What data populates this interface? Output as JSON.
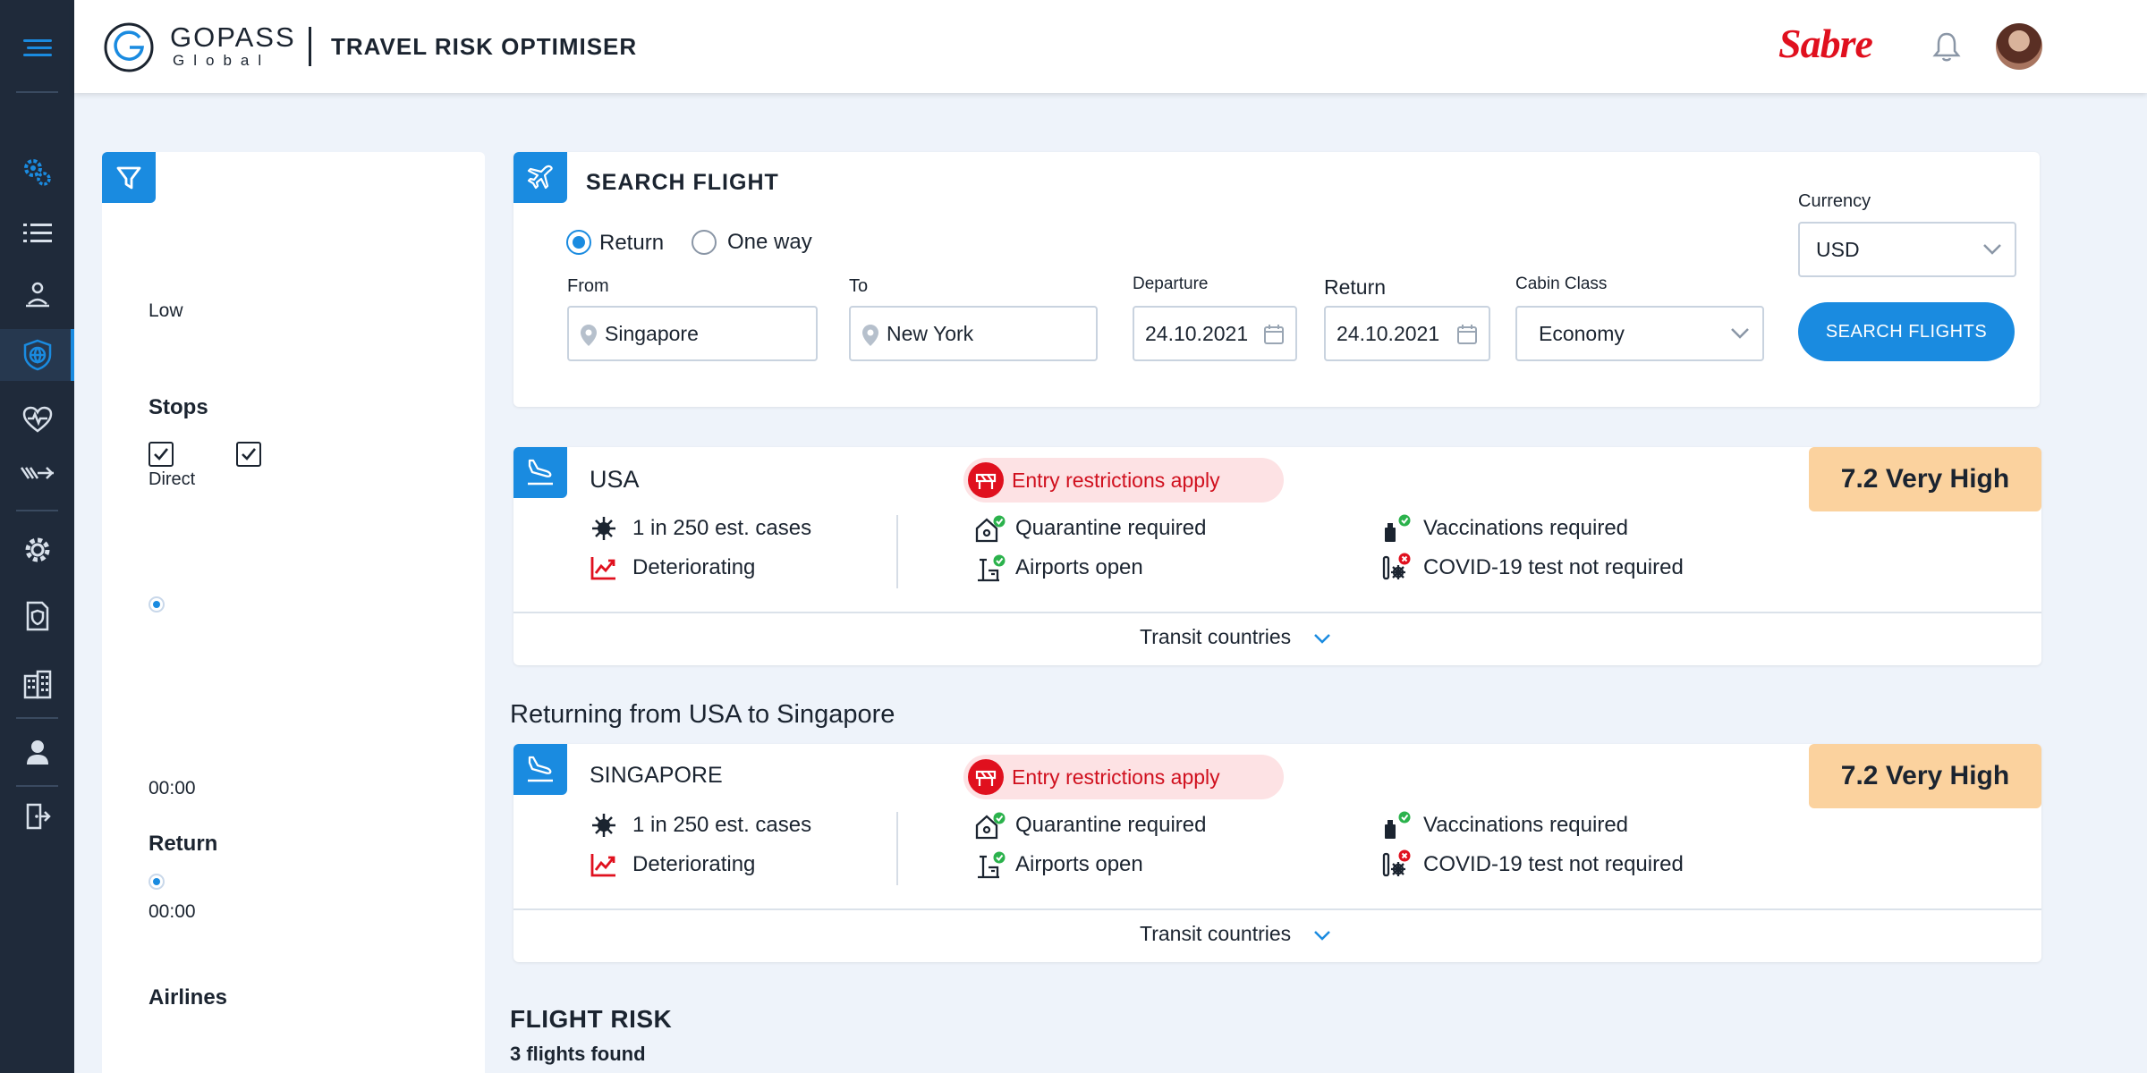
{
  "header": {
    "brand_line1": "GOPASS",
    "brand_line2": "Global",
    "app_title": "TRAVEL RISK OPTIMISER",
    "partner_logo": "Sabre",
    "icons": {
      "menu": "hamburger-icon",
      "bell": "bell-icon"
    }
  },
  "nav": {
    "items": [
      {
        "icon": "gears-icon",
        "active": false
      },
      {
        "icon": "list-icon",
        "active": false
      },
      {
        "icon": "location-person-icon",
        "active": false
      },
      {
        "icon": "shield-globe-icon",
        "active": true
      },
      {
        "icon": "heart-pulse-icon",
        "active": false
      },
      {
        "icon": "flight-speed-icon",
        "active": false
      },
      {
        "icon": "gear-icon",
        "active": false
      },
      {
        "icon": "document-shield-icon",
        "active": false
      },
      {
        "icon": "building-icon",
        "active": false
      },
      {
        "icon": "user-icon",
        "active": false
      },
      {
        "icon": "logout-icon",
        "active": false
      }
    ]
  },
  "filters": {
    "risk_level_label": "Low",
    "stops": {
      "heading": "Stops",
      "direct_label": "Direct"
    },
    "departure_time": "00:00",
    "return": {
      "heading": "Return",
      "time": "00:00"
    },
    "airlines_heading": "Airlines"
  },
  "search": {
    "title": "SEARCH FLIGHT",
    "trip_type": {
      "return_label": "Return",
      "oneway_label": "One way",
      "selected": "Return"
    },
    "from": {
      "label": "From",
      "value": "Singapore"
    },
    "to": {
      "label": "To",
      "value": "New York"
    },
    "departure": {
      "label": "Departure",
      "value": "24.10.2021"
    },
    "return_date": {
      "label": "Return",
      "value": "24.10.2021"
    },
    "cabin": {
      "label": "Cabin Class",
      "value": "Economy"
    },
    "currency": {
      "label": "Currency",
      "value": "USD"
    },
    "button_label": "SEARCH FLIGHTS"
  },
  "destinations": [
    {
      "country": "USA",
      "entry": "Entry restrictions apply",
      "risk": "7.2 Very High",
      "cases": "1 in 250 est. cases",
      "trend": "Deteriorating",
      "quarantine": "Quarantine required",
      "airports": "Airports open",
      "vaccinations": "Vaccinations required",
      "test": "COVID-19 test not required",
      "transit": "Transit countries"
    },
    {
      "country": "SINGAPORE",
      "entry": "Entry restrictions apply",
      "risk": "7.2 Very High",
      "cases": "1 in 250 est. cases",
      "trend": "Deteriorating",
      "quarantine": "Quarantine required",
      "airports": "Airports open",
      "vaccinations": "Vaccinations required",
      "test": "COVID-19 test not required",
      "transit": "Transit countries"
    }
  ],
  "returning_heading": "Returning from USA to Singapore",
  "flight_risk": {
    "title": "FLIGHT RISK",
    "count": "3 flights found"
  },
  "colors": {
    "accent": "#1a8be0",
    "rail": "#1f2a3a",
    "danger": "#e0101e",
    "risk_badge": "#fbd29e",
    "ok": "#2bb24c"
  }
}
